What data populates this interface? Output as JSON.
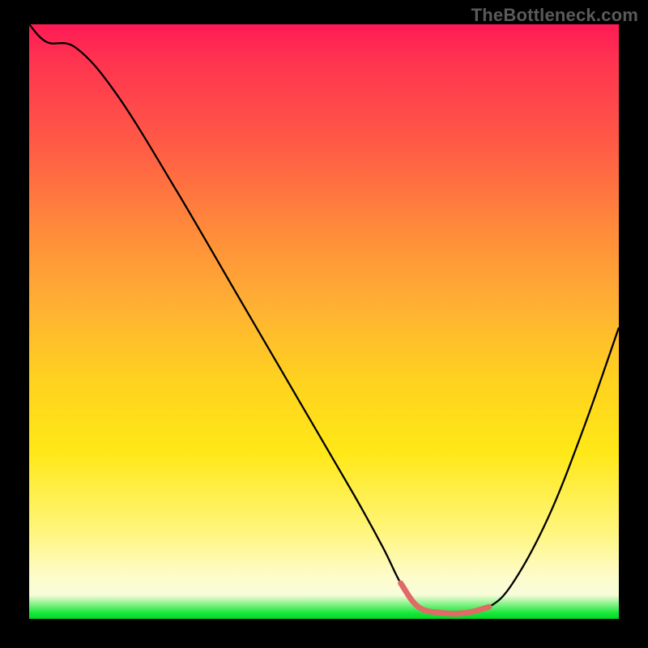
{
  "watermark": "TheBottleneck.com",
  "colors": {
    "background": "#000000",
    "curve": "#000000",
    "trough_highlight": "#e06a66",
    "watermark_text": "#5a5a5a"
  },
  "chart_data": {
    "type": "line",
    "title": "",
    "xlabel": "",
    "ylabel": "",
    "xlim": [
      0,
      100
    ],
    "ylim": [
      0,
      100
    ],
    "grid": false,
    "series": [
      {
        "name": "bottleneck-curve",
        "x": [
          0,
          3,
          8,
          15,
          25,
          35,
          45,
          55,
          60,
          63,
          66,
          70,
          74,
          78,
          82,
          88,
          94,
          100
        ],
        "values": [
          100,
          97,
          96,
          88,
          72,
          55,
          38,
          21,
          12,
          6,
          2,
          1,
          1,
          2,
          6,
          17,
          32,
          49
        ]
      }
    ],
    "annotations": [
      {
        "name": "optimal-trough",
        "x_range": [
          63,
          78
        ],
        "note": "highlighted segment at curve minimum"
      }
    ]
  }
}
